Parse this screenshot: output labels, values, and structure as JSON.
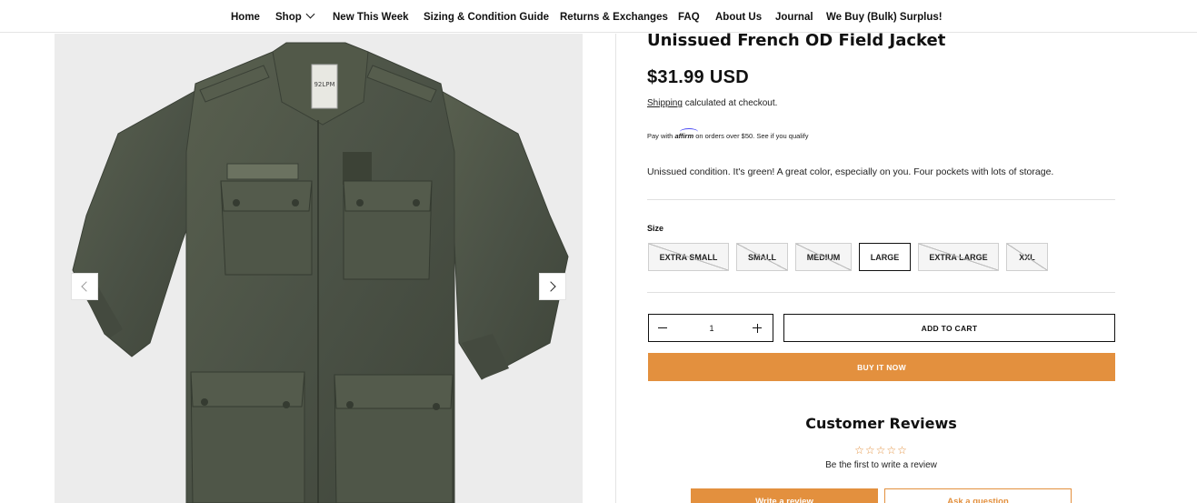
{
  "nav": {
    "items": [
      {
        "label": "Home"
      },
      {
        "label": "Shop"
      },
      {
        "label": "New This Week"
      },
      {
        "label": "Sizing & Condition Guide"
      },
      {
        "label": "Returns & Exchanges"
      },
      {
        "label": "FAQ"
      },
      {
        "label": "About Us"
      },
      {
        "label": "Journal"
      },
      {
        "label": "We Buy (Bulk) Surplus!"
      }
    ]
  },
  "gallery": {
    "image_subject": "olive green field jacket",
    "label_tag": "92LPM"
  },
  "product": {
    "title": "Unissued French OD Field Jacket",
    "price": "$31.99 USD",
    "shipping_link": "Shipping",
    "shipping_text": " calculated at checkout.",
    "affirm_prefix": "Pay with ",
    "affirm_logo": "affirm",
    "affirm_suffix": " on orders over $50. See if you qualify",
    "description": "Unissued condition. It's green! A great color, especially on you. Four pockets with lots of storage."
  },
  "size": {
    "label": "Size",
    "options": [
      {
        "label": "EXTRA SMALL",
        "available": false
      },
      {
        "label": "SMALL",
        "available": false
      },
      {
        "label": "MEDIUM",
        "available": false
      },
      {
        "label": "LARGE",
        "available": true,
        "selected": true
      },
      {
        "label": "EXTRA LARGE",
        "available": false
      },
      {
        "label": "XXL",
        "available": false
      }
    ]
  },
  "purchase": {
    "quantity": "1",
    "add_to_cart": "ADD TO CART",
    "buy_now": "BUY IT NOW"
  },
  "reviews": {
    "title": "Customer Reviews",
    "stars": "☆☆☆☆☆",
    "empty_text": "Be the first to write a review",
    "write_button": "Write a review",
    "ask_button": "Ask a question"
  },
  "colors": {
    "accent": "#e3903e",
    "jacket": "#4b5246"
  }
}
